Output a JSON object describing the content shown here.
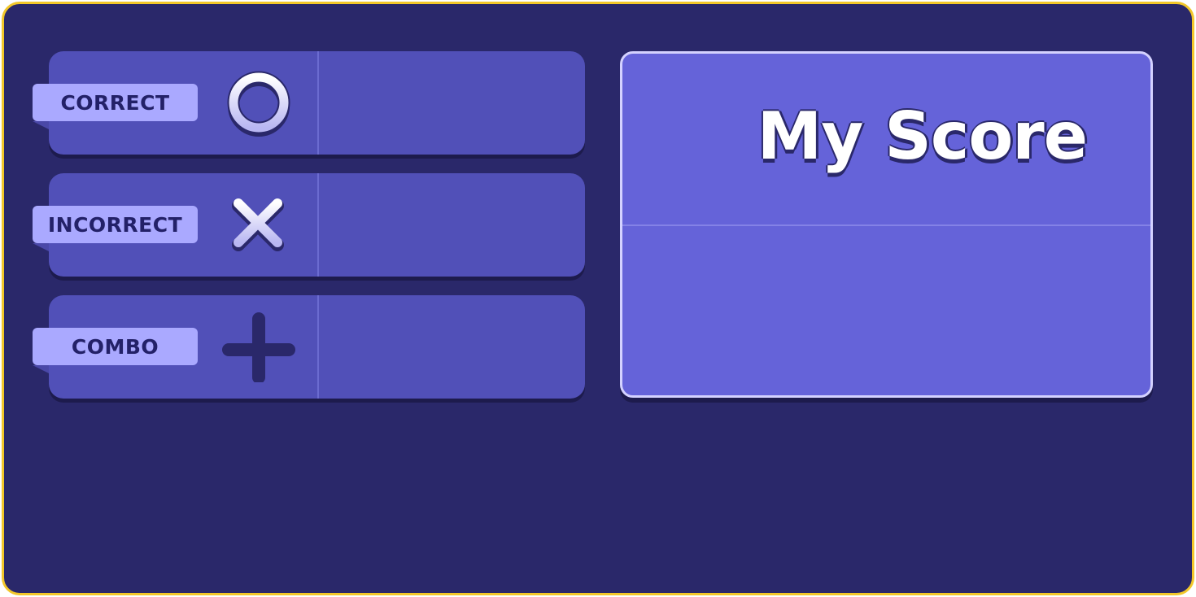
{
  "stats": [
    {
      "label": "CORRECT",
      "icon": "circle-icon",
      "value": ""
    },
    {
      "label": "INCORRECT",
      "icon": "cross-icon",
      "value": ""
    },
    {
      "label": "COMBO",
      "icon": "plus-icon",
      "value": ""
    }
  ],
  "score_panel": {
    "title": "My Score",
    "value": ""
  },
  "colors": {
    "frame_border": "#f2c72a",
    "background": "#2a286a",
    "row_fill": "#5150b8",
    "tag_fill": "#aaa9ff",
    "panel_fill": "#6563d9",
    "panel_border": "#d4d2ff"
  }
}
